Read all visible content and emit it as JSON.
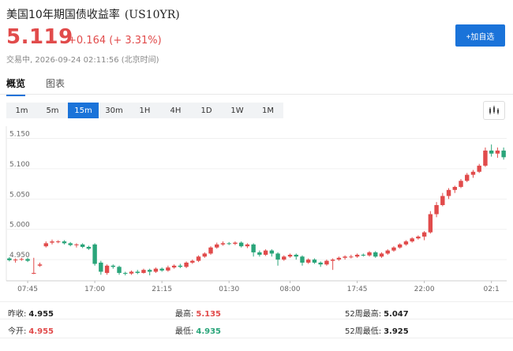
{
  "header": {
    "title": "美国10年期国债收益率",
    "code": "(US10YR)",
    "price": "5.119",
    "change": "+0.164 (+ 3.31%)",
    "status": "交易中, 2026-09-24 02:11:56 (北京时间)",
    "add_button": "+加自选"
  },
  "tabs": [
    {
      "label": "概览",
      "active": true
    },
    {
      "label": "图表",
      "active": false
    }
  ],
  "periods": [
    {
      "label": "1m",
      "active": false
    },
    {
      "label": "5m",
      "active": false
    },
    {
      "label": "15m",
      "active": true
    },
    {
      "label": "30m",
      "active": false
    },
    {
      "label": "1H",
      "active": false
    },
    {
      "label": "4H",
      "active": false
    },
    {
      "label": "1D",
      "active": false
    },
    {
      "label": "1W",
      "active": false
    },
    {
      "label": "1M",
      "active": false
    }
  ],
  "colors": {
    "up": "#e14b4b",
    "down": "#2aa57a",
    "accent": "#1a73d9"
  },
  "chart_data": {
    "type": "candlestick",
    "y_ticks": [
      "5.150",
      "5.100",
      "5.050",
      "5.000",
      "4.950"
    ],
    "y_tick_values": [
      5.15,
      5.1,
      5.05,
      5.0,
      4.95
    ],
    "ylim": [
      4.915,
      5.165
    ],
    "x_ticks": [
      {
        "label": "07:45",
        "index": 3
      },
      {
        "label": "17:00",
        "index": 14
      },
      {
        "label": "21:15",
        "index": 25
      },
      {
        "label": "01:30",
        "index": 36
      },
      {
        "label": "08:00",
        "index": 46
      },
      {
        "label": "17:45",
        "index": 57
      },
      {
        "label": "22:00",
        "index": 68
      },
      {
        "label": "02:1",
        "index": 79
      }
    ],
    "candles": [
      [
        4.952,
        4.949,
        4.954,
        4.947
      ],
      [
        4.949,
        4.95,
        4.952,
        4.945
      ],
      [
        4.95,
        4.951,
        4.953,
        4.948
      ],
      [
        4.951,
        4.948,
        4.953,
        4.946
      ],
      [
        4.927,
        4.928,
        4.953,
        4.926
      ],
      [
        4.94,
        4.942,
        4.945,
        4.938
      ],
      [
        4.972,
        4.977,
        4.98,
        4.97
      ],
      [
        4.978,
        4.98,
        4.983,
        4.975
      ],
      [
        4.98,
        4.98,
        4.982,
        4.977
      ],
      [
        4.98,
        4.977,
        4.982,
        4.975
      ],
      [
        4.977,
        4.974,
        4.979,
        4.972
      ],
      [
        4.974,
        4.975,
        4.977,
        4.97
      ],
      [
        4.975,
        4.971,
        4.977,
        4.969
      ],
      [
        4.971,
        4.968,
        4.973,
        4.966
      ],
      [
        4.975,
        4.943,
        4.977,
        4.94
      ],
      [
        4.945,
        4.93,
        4.948,
        4.925
      ],
      [
        4.928,
        4.94,
        4.942,
        4.925
      ],
      [
        4.94,
        4.938,
        4.942,
        4.935
      ],
      [
        4.938,
        4.928,
        4.94,
        4.925
      ],
      [
        4.928,
        4.927,
        4.93,
        4.924
      ],
      [
        4.927,
        4.93,
        4.932,
        4.925
      ],
      [
        4.93,
        4.928,
        4.933,
        4.926
      ],
      [
        4.928,
        4.933,
        4.935,
        4.927
      ],
      [
        4.933,
        4.93,
        4.935,
        4.924
      ],
      [
        4.93,
        4.935,
        4.937,
        4.928
      ],
      [
        4.935,
        4.932,
        4.937,
        4.93
      ],
      [
        4.932,
        4.937,
        4.94,
        4.93
      ],
      [
        4.937,
        4.94,
        4.942,
        4.935
      ],
      [
        4.94,
        4.938,
        4.943,
        4.936
      ],
      [
        4.938,
        4.945,
        4.947,
        4.936
      ],
      [
        4.945,
        4.948,
        4.95,
        4.943
      ],
      [
        4.948,
        4.955,
        4.957,
        4.946
      ],
      [
        4.955,
        4.96,
        4.962,
        4.953
      ],
      [
        4.96,
        4.97,
        4.972,
        4.958
      ],
      [
        4.97,
        4.975,
        4.978,
        4.968
      ],
      [
        4.975,
        4.977,
        4.98,
        4.973
      ],
      [
        4.977,
        4.976,
        4.979,
        4.974
      ],
      [
        4.976,
        4.978,
        4.98,
        4.974
      ],
      [
        4.978,
        4.972,
        4.98,
        4.97
      ],
      [
        4.972,
        4.975,
        4.977,
        4.969
      ],
      [
        4.975,
        4.962,
        4.977,
        4.955
      ],
      [
        4.962,
        4.958,
        4.965,
        4.955
      ],
      [
        4.958,
        4.965,
        4.967,
        4.956
      ],
      [
        4.965,
        4.96,
        4.967,
        4.955
      ],
      [
        4.96,
        4.95,
        4.962,
        4.94
      ],
      [
        4.95,
        4.955,
        4.957,
        4.948
      ],
      [
        4.955,
        4.958,
        4.96,
        4.953
      ],
      [
        4.958,
        4.955,
        4.96,
        4.95
      ],
      [
        4.955,
        4.945,
        4.957,
        4.94
      ],
      [
        4.945,
        4.95,
        4.952,
        4.943
      ],
      [
        4.95,
        4.945,
        4.952,
        4.943
      ],
      [
        4.945,
        4.942,
        4.947,
        4.938
      ],
      [
        4.942,
        4.948,
        4.95,
        4.94
      ],
      [
        4.948,
        4.95,
        4.952,
        4.933
      ],
      [
        4.95,
        4.953,
        4.955,
        4.948
      ],
      [
        4.953,
        4.955,
        4.957,
        4.95
      ],
      [
        4.955,
        4.955,
        4.958,
        4.952
      ],
      [
        4.955,
        4.958,
        4.96,
        4.953
      ],
      [
        4.958,
        4.957,
        4.96,
        4.955
      ],
      [
        4.957,
        4.962,
        4.964,
        4.955
      ],
      [
        4.962,
        4.955,
        4.964,
        4.953
      ],
      [
        4.955,
        4.96,
        4.962,
        4.953
      ],
      [
        4.96,
        4.965,
        4.967,
        4.958
      ],
      [
        4.965,
        4.97,
        4.972,
        4.963
      ],
      [
        4.97,
        4.975,
        4.977,
        4.968
      ],
      [
        4.975,
        4.98,
        4.982,
        4.973
      ],
      [
        4.98,
        4.985,
        4.987,
        4.978
      ],
      [
        4.985,
        4.988,
        4.99,
        4.983
      ],
      [
        4.988,
        4.995,
        4.997,
        4.982
      ],
      [
        4.995,
        5.025,
        5.03,
        4.993
      ],
      [
        5.025,
        5.04,
        5.045,
        5.02
      ],
      [
        5.04,
        5.055,
        5.06,
        5.038
      ],
      [
        5.055,
        5.065,
        5.068,
        5.05
      ],
      [
        5.065,
        5.07,
        5.072,
        5.06
      ],
      [
        5.07,
        5.08,
        5.083,
        5.068
      ],
      [
        5.08,
        5.09,
        5.093,
        5.078
      ],
      [
        5.09,
        5.095,
        5.098,
        5.085
      ],
      [
        5.095,
        5.105,
        5.108,
        5.093
      ],
      [
        5.105,
        5.13,
        5.135,
        5.103
      ],
      [
        5.13,
        5.125,
        5.14,
        5.12
      ],
      [
        5.125,
        5.13,
        5.135,
        5.118
      ],
      [
        5.13,
        5.119,
        5.135,
        5.115
      ]
    ]
  },
  "stats": {
    "prev_close_label": "昨收:",
    "prev_close": "4.955",
    "high_label": "最高:",
    "high": "5.135",
    "wk52_high_label": "52周最高:",
    "wk52_high": "5.047",
    "open_label": "今开:",
    "open": "4.955",
    "low_label": "最低:",
    "low": "4.935",
    "wk52_low_label": "52周最低:",
    "wk52_low": "3.925"
  }
}
